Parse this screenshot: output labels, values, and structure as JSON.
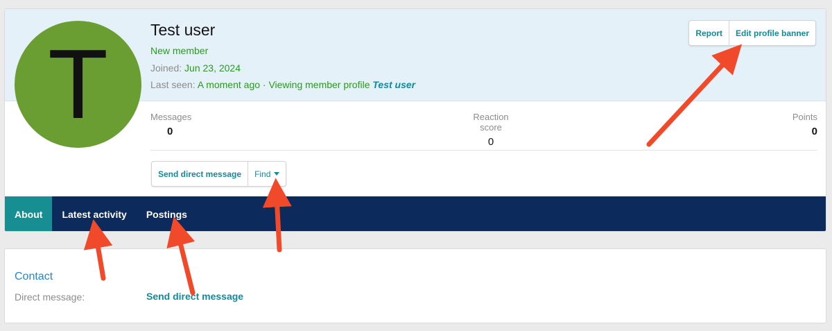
{
  "profile": {
    "avatar_letter": "T",
    "avatar_color": "#6a9e32",
    "username": "Test user",
    "user_title": "New member",
    "joined_label": "Joined:",
    "joined_value": "Jun 23, 2024",
    "last_seen_label": "Last seen:",
    "last_seen_value": "A moment ago · Viewing member profile",
    "last_seen_target": "Test user"
  },
  "actions": {
    "report": "Report",
    "edit_banner": "Edit profile banner",
    "send_dm": "Send direct message",
    "find": "Find"
  },
  "stats": {
    "messages_label": "Messages",
    "messages_value": "0",
    "reaction_label": "Reaction score",
    "reaction_value": "0",
    "points_label": "Points",
    "points_value": "0"
  },
  "tabs": [
    {
      "label": "About",
      "active": true
    },
    {
      "label": "Latest activity",
      "active": false
    },
    {
      "label": "Postings",
      "active": false
    }
  ],
  "contact": {
    "title": "Contact",
    "dm_label": "Direct message:",
    "dm_link": "Send direct message"
  },
  "colors": {
    "accent": "#138a9a",
    "tab_bar": "#0d2a5c",
    "tab_active": "#178f92",
    "banner": "#e4f1f8",
    "annotation_arrow": "#f04a2a"
  }
}
